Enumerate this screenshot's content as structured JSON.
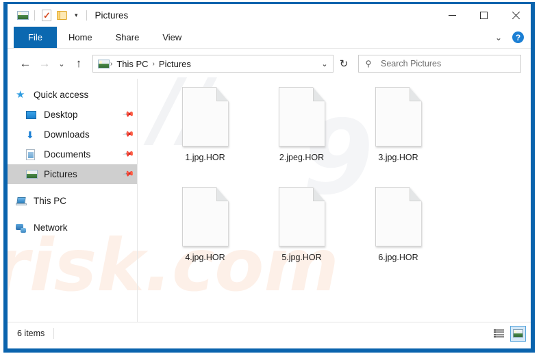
{
  "window": {
    "title": "Pictures",
    "border_color": "#0a63ad"
  },
  "quick_access_toolbar": {
    "items": [
      {
        "name": "pictures-icon",
        "label": "Pictures"
      },
      {
        "name": "properties-icon",
        "label": "Properties"
      },
      {
        "name": "new-folder-icon",
        "label": "New folder"
      }
    ],
    "caret": "▾"
  },
  "window_controls": {
    "minimize": "—",
    "maximize": "□",
    "close": "✕"
  },
  "ribbon": {
    "tabs": [
      {
        "label": "File",
        "active": true
      },
      {
        "label": "Home",
        "active": false
      },
      {
        "label": "Share",
        "active": false
      },
      {
        "label": "View",
        "active": false
      }
    ],
    "collapse_caret": "⌄",
    "help_label": "?"
  },
  "navigation": {
    "back": "←",
    "forward": "→",
    "recent": "⌄",
    "up": "↑"
  },
  "address_bar": {
    "crumbs": [
      {
        "label": "This PC"
      },
      {
        "label": "Pictures"
      }
    ],
    "separator": "›",
    "dropdown_caret": "⌄",
    "refresh": "↻"
  },
  "search": {
    "placeholder": "Search Pictures",
    "icon": "⚲"
  },
  "sidebar": {
    "items": [
      {
        "label": "Quick access",
        "icon": "star-icon",
        "level": "root",
        "pinned": false,
        "selected": false
      },
      {
        "label": "Desktop",
        "icon": "desktop-icon",
        "level": "child",
        "pinned": true,
        "selected": false
      },
      {
        "label": "Downloads",
        "icon": "downloads-icon",
        "level": "child",
        "pinned": true,
        "selected": false
      },
      {
        "label": "Documents",
        "icon": "documents-icon",
        "level": "child",
        "pinned": true,
        "selected": false
      },
      {
        "label": "Pictures",
        "icon": "pictures-icon",
        "level": "child",
        "pinned": true,
        "selected": true
      },
      {
        "label": "This PC",
        "icon": "this-pc-icon",
        "level": "root",
        "pinned": false,
        "selected": false
      },
      {
        "label": "Network",
        "icon": "network-icon",
        "level": "root",
        "pinned": false,
        "selected": false
      }
    ],
    "pin_glyph": "📌"
  },
  "files": [
    {
      "name": "1.jpg.HOR"
    },
    {
      "name": "2.jpeg.HOR"
    },
    {
      "name": "3.jpg.HOR"
    },
    {
      "name": "4.jpg.HOR"
    },
    {
      "name": "5.jpg.HOR"
    },
    {
      "name": "6.jpg.HOR"
    }
  ],
  "status_bar": {
    "item_count": "6 items",
    "views": [
      {
        "name": "details-view",
        "active": false
      },
      {
        "name": "large-icons-view",
        "active": true
      }
    ]
  },
  "watermark": {
    "line1": "//",
    "line2": "risk.com",
    "line3": "9"
  }
}
